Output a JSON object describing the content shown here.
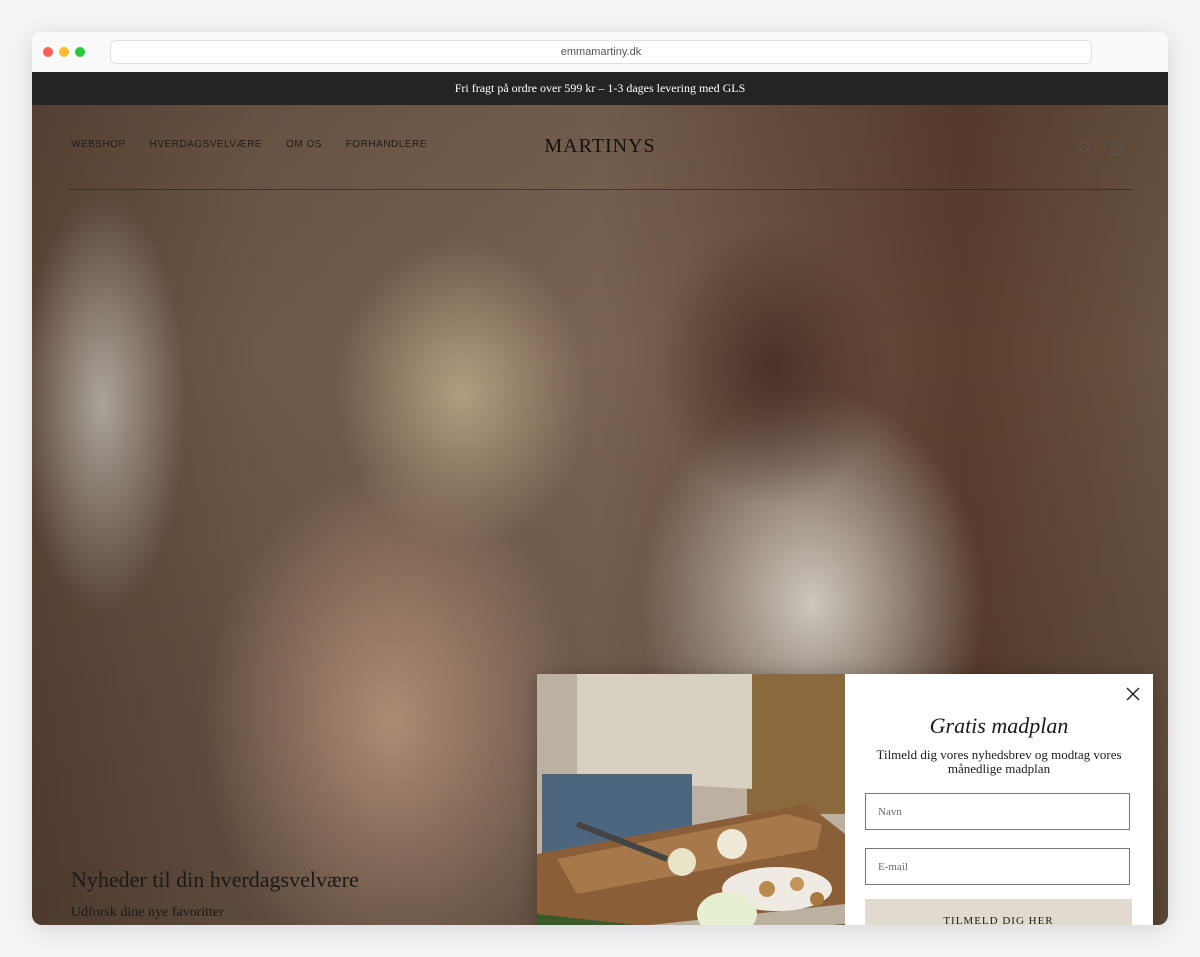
{
  "browser": {
    "url": "emmamartiny.dk"
  },
  "promo_bar": {
    "text": "Fri fragt på ordre over 599 kr – 1-3 dages levering med GLS"
  },
  "header": {
    "nav": [
      {
        "label": "WEBSHOP"
      },
      {
        "label": "HVERDAGSVELVÆRE"
      },
      {
        "label": "OM OS"
      },
      {
        "label": "FORHANDLERE"
      }
    ],
    "logo": "MARTINYS",
    "icons": [
      "search-icon",
      "bag-icon"
    ]
  },
  "hero": {
    "title": "Nyheder til din hverdagsvelvære",
    "subtitle": "Udforsk dine nye favoritter"
  },
  "popup": {
    "title": "Gratis madplan",
    "text": "Tilmeld dig vores nyhedsbrev og modtag vores månedlige madplan",
    "name_placeholder": "Navn",
    "email_placeholder": "E-mail",
    "submit_label": "TILMELD DIG HER",
    "button_color": "#e0dbce"
  }
}
